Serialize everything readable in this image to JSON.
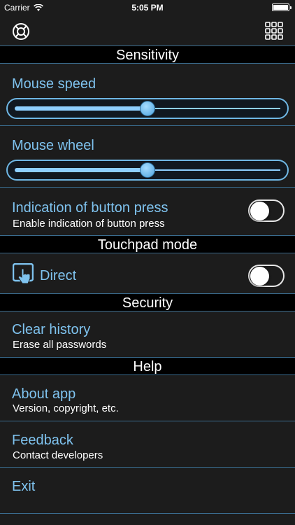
{
  "status_bar": {
    "carrier": "Carrier",
    "time": "5:05 PM",
    "icons": [
      "wifi-icon",
      "battery-icon"
    ]
  },
  "nav": {
    "left_icon": "lifebuoy-help-icon",
    "right_icon": "grid-menu-icon"
  },
  "sections": {
    "sensitivity": "Sensitivity",
    "touchpad": "Touchpad mode",
    "security": "Security",
    "help": "Help"
  },
  "sensitivity": {
    "mouse_speed": {
      "label": "Mouse speed",
      "value": 0.5
    },
    "mouse_wheel": {
      "label": "Mouse wheel",
      "value": 0.5
    },
    "button_press": {
      "title": "Indication of button press",
      "subtitle": "Enable indication of button press",
      "enabled": false
    }
  },
  "touchpad": {
    "direct": {
      "label": "Direct",
      "icon": "touch-hand-icon",
      "enabled": false
    }
  },
  "security": {
    "clear_history": {
      "title": "Clear history",
      "subtitle": "Erase all passwords"
    }
  },
  "help": {
    "about": {
      "title": "About app",
      "subtitle": "Version, copyright, etc."
    },
    "feedback": {
      "title": "Feedback",
      "subtitle": "Contact developers"
    },
    "exit": {
      "title": "Exit"
    }
  },
  "colors": {
    "background": "#1c1c1c",
    "header_background": "#000000",
    "accent_blue": "#7fc3ef",
    "divider": "#3a6c8f"
  }
}
